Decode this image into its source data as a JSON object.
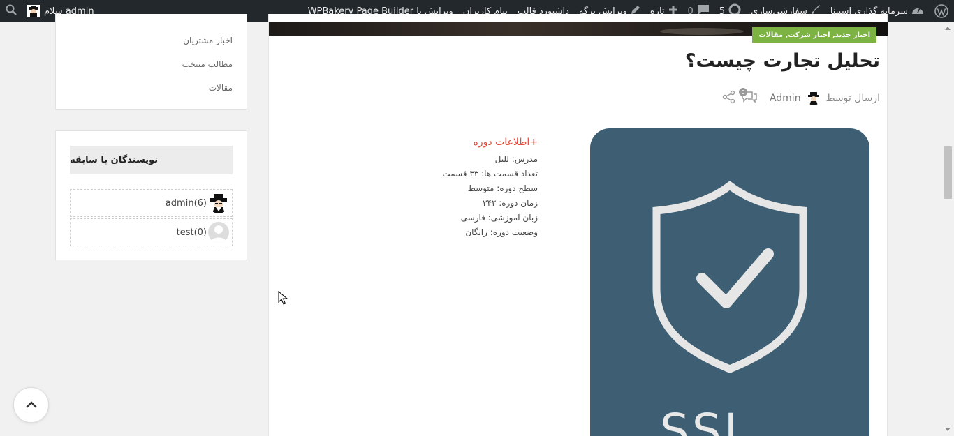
{
  "adminbar": {
    "site_name": "سرمایه گذاری اسپینا",
    "customize": "سفارشی‌سازی",
    "updates_count": "5",
    "comments_count": "0",
    "new_label": "تازه",
    "edit_page": "ویرایش برگه",
    "theme_dashboard": "داشبورد قالب",
    "user_messages": "پیام کاربران",
    "wpbakery": "ویرایش با WPBakery Page Builder",
    "greeting": "سلام admin"
  },
  "sidebar": {
    "categories": [
      "اخبار مشتریان",
      "مطالب منتخب",
      "مقالات"
    ],
    "authors_widget_title": "نویسندگان با سابقه",
    "authors": [
      {
        "label": "(admin(6"
      },
      {
        "label": "(test(0"
      }
    ]
  },
  "article": {
    "categories_badge": "اخبار جدید, اخبار شرکت, مقالات",
    "title": "تحلیل تجارت چیست؟",
    "posted_by": "ارسال توسط",
    "author": "Admin",
    "comment_count": "0",
    "image_text": "SSL",
    "course_info": {
      "heading": "+اطلاعات دوره",
      "lines": [
        "مدرس: للیل",
        "تعداد قسمت ها: ۳۳ قسمت",
        "سطح دوره: متوسط",
        "زمان دوره: ۳۴۲",
        "زبان آموزشی: فارسی",
        "وضعیت دوره: رایگان"
      ]
    }
  },
  "colors": {
    "adminbar_bg": "#23282d",
    "badge_green": "#7cb342",
    "course_heading_red": "#e24a3b",
    "image_bg": "#3e5f73"
  },
  "icons": {
    "wp_logo": "wordpress-logo-icon",
    "dashboard": "dashboard-icon",
    "brush": "paintbrush-icon",
    "updates": "refresh-icon",
    "comments": "comment-bubble-icon",
    "plus": "plus-icon",
    "pencil": "pencil-icon",
    "search": "search-icon",
    "back_to_top": "chevron-up-icon",
    "share": "share-icon",
    "shield": "shield-check-icon"
  }
}
